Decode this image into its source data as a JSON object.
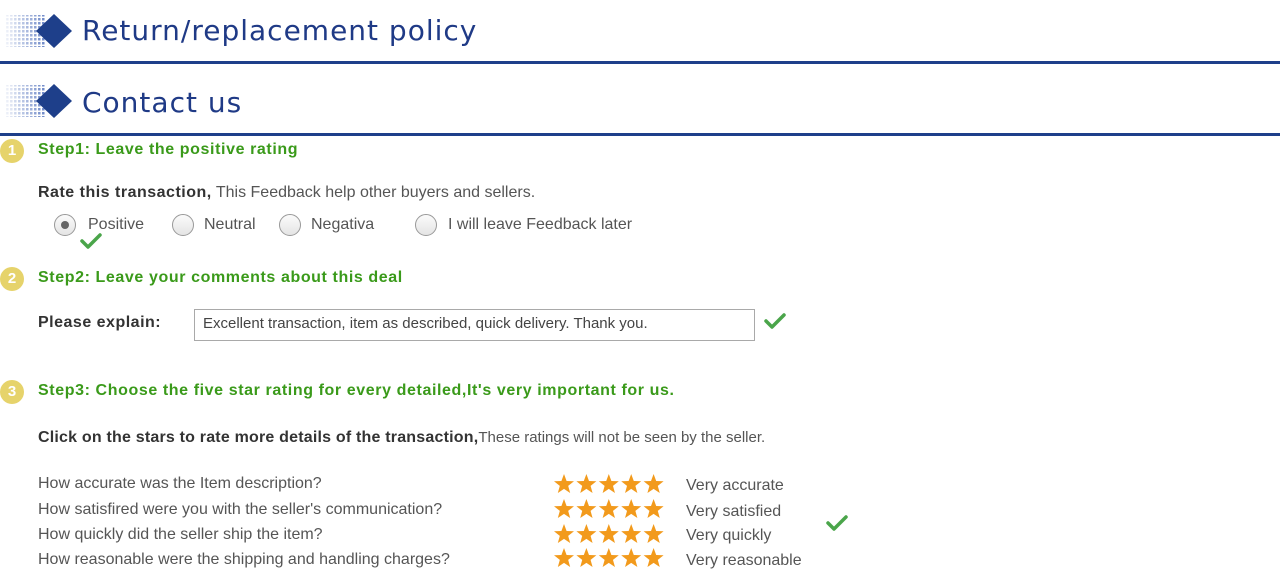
{
  "headers": [
    {
      "title": "Return/replacement policy"
    },
    {
      "title": "Contact us"
    }
  ],
  "step1": {
    "number": "1",
    "title": "Step1: Leave the positive rating",
    "rate_label": "Rate this transaction,",
    "rate_desc": " This Feedback help other buyers and sellers.",
    "options": [
      {
        "label": "Positive",
        "checked": true
      },
      {
        "label": "Neutral",
        "checked": false
      },
      {
        "label": "Negativa",
        "checked": false
      },
      {
        "label": "I will leave Feedback later",
        "checked": false
      }
    ]
  },
  "step2": {
    "number": "2",
    "title": "Step2: Leave your comments about this deal",
    "explain_label": "Please explain:",
    "comment_value": "Excellent transaction, item as described, quick delivery. Thank you."
  },
  "step3": {
    "number": "3",
    "title": "Step3: Choose the five star rating for every detailed,It's very important for us.",
    "instruction_bold": "Click on the stars to rate more details of the transaction,",
    "instruction_plain": "These ratings will not be seen by the seller.",
    "ratings": [
      {
        "question": "How accurate was the Item description?",
        "stars": 5,
        "answer": "Very accurate"
      },
      {
        "question": "How satisfired were you with the seller's communication?",
        "stars": 5,
        "answer": "Very satisfied"
      },
      {
        "question": "How quickly did the seller ship the item?",
        "stars": 5,
        "answer": "Very quickly"
      },
      {
        "question": "How reasonable were the shipping and handling charges?",
        "stars": 5,
        "answer": "Very reasonable"
      }
    ]
  },
  "colors": {
    "header_blue": "#1f3a86",
    "step_green": "#3a9a1a",
    "badge_yellow": "#e6d36b",
    "star_orange": "#f29a1c",
    "check_green": "#4aa54a"
  },
  "icons": [
    "header-diamond-icon",
    "radio",
    "checkmark-icon",
    "star-icon"
  ]
}
